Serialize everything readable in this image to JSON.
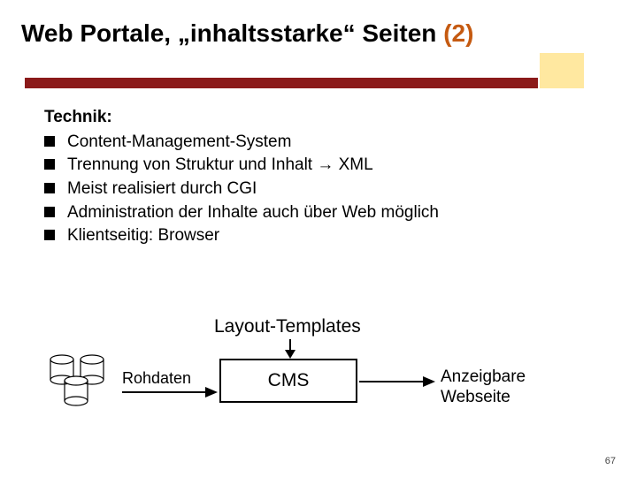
{
  "title_main": "Web Portale, „inhaltsstarke“ Seiten ",
  "title_suffix": "(2)",
  "section_heading": "Technik:",
  "bullets": [
    "Content-Management-System",
    "Trennung von Struktur und Inhalt → XML",
    "Meist realisiert durch CGI",
    "Administration der Inhalte auch über Web möglich",
    "Klientseitig: Browser"
  ],
  "diagram": {
    "layout_templates": "Layout-Templates",
    "rohdaten": "Rohdaten",
    "cms": "CMS",
    "output_line1": "Anzeigbare",
    "output_line2": "Webseite"
  },
  "page_number": "67"
}
